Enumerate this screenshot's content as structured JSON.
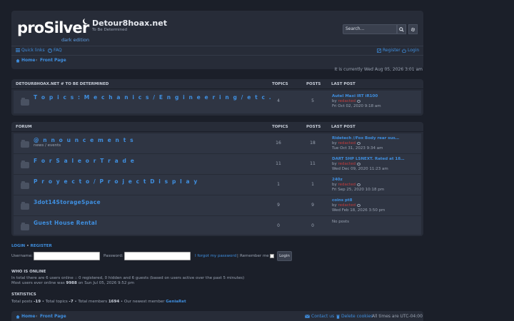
{
  "logo": {
    "main": "proSilver",
    "sub": "dark edition"
  },
  "site": {
    "title": "Detour8hoax.net",
    "description": "To Be Determined"
  },
  "search": {
    "placeholder": "Search…",
    "search_icon": "search-icon",
    "advanced_icon": "gear-icon"
  },
  "nav": {
    "quick_links": "Quick links",
    "faq": "FAQ",
    "register": "Register",
    "login": "Login",
    "home": "Home",
    "front_page": "Front Page",
    "separator": "‹"
  },
  "current_time": "It is currently Wed Aug 05, 2026 3:01 am",
  "category1": {
    "header": "DETOUR8HOAX.NET # TO BE DETERMINED",
    "topics_label": "TOPICS",
    "posts_label": "POSTS",
    "lastpost_label": "LAST POST",
    "forums": [
      {
        "title": "T o p i c s : M e c h a n i c s / E n g i n e e r i n g / e t c .",
        "topics": "4",
        "posts": "5",
        "last_title": "Autel Maxi IRT iR100",
        "by": "by",
        "last_user": "redacted",
        "last_date": "Fri Oct 02, 2020 9:18 am"
      }
    ]
  },
  "category2": {
    "header": "FORUM",
    "topics_label": "TOPICS",
    "posts_label": "POSTS",
    "lastpost_label": "LAST POST",
    "forums": [
      {
        "title": "@ n n o u n c e m e n t s",
        "desc": "news / events",
        "topics": "16",
        "posts": "18",
        "last_title": "Ridetech //Fox Body rear sus…",
        "by": "by",
        "last_user": "redacted",
        "last_date": "Tue Oct 31, 2023 9:34 am"
      },
      {
        "title": "F o r S a l e o r T r a d e",
        "topics": "11",
        "posts": "11",
        "last_title": "DART SHP LSNEXT. Rated at 18…",
        "by": "by",
        "last_user": "redacted",
        "last_date": "Wed Dec 09, 2020 11:23 am"
      },
      {
        "title": "P r o y e c t o / P r o j e c t D i s p l a y",
        "topics": "1",
        "posts": "1",
        "last_title": "240z",
        "by": "by",
        "last_user": "redacted",
        "last_date": "Fri Sep 25, 2020 10:18 pm"
      },
      {
        "title": "3dot14StorageSpace",
        "topics": "9",
        "posts": "9",
        "last_title": "coins pt8",
        "by": "by",
        "last_user": "redacted",
        "last_date": "Wed Feb 18, 2026 3:50 pm"
      },
      {
        "title": "Guest House Rental",
        "topics": "0",
        "posts": "0",
        "last_none": "No posts"
      }
    ]
  },
  "login": {
    "login_link": "LOGIN",
    "dot": "•",
    "register_link": "REGISTER",
    "username_label": "Username:",
    "password_label": "Password:",
    "forgot": "I forgot my password",
    "pipe": "|",
    "remember": "Remember me",
    "button": "Login"
  },
  "who_is_online": {
    "heading": "WHO IS ONLINE",
    "line1": "In total there are 6 users online :: 0 registered, 0 hidden and 6 guests (based on users active over the past 5 minutes)",
    "line2_prefix": "Most users ever online was ",
    "line2_count": "9988",
    "line2_suffix": " on Sun Jul 05, 2026 9:52 pm"
  },
  "statistics": {
    "heading": "STATISTICS",
    "prefix1": "Total posts ",
    "posts": "-19",
    "prefix2": " • Total topics ",
    "topics": "-7",
    "prefix3": " • Total members ",
    "members": "1694",
    "prefix4": " • Our newest member ",
    "newest": "GeniaRet"
  },
  "footer": {
    "home": "Home",
    "front_page": "Front Page",
    "contact": "Contact us",
    "delete_cookies": "Delete cookies",
    "times": "All times are UTC-04:00"
  },
  "colors": {
    "bg": "#1b1f29",
    "panel": "#272c38",
    "row": "#2f3543",
    "link": "#3f8fe0",
    "user": "#c43c3c"
  }
}
